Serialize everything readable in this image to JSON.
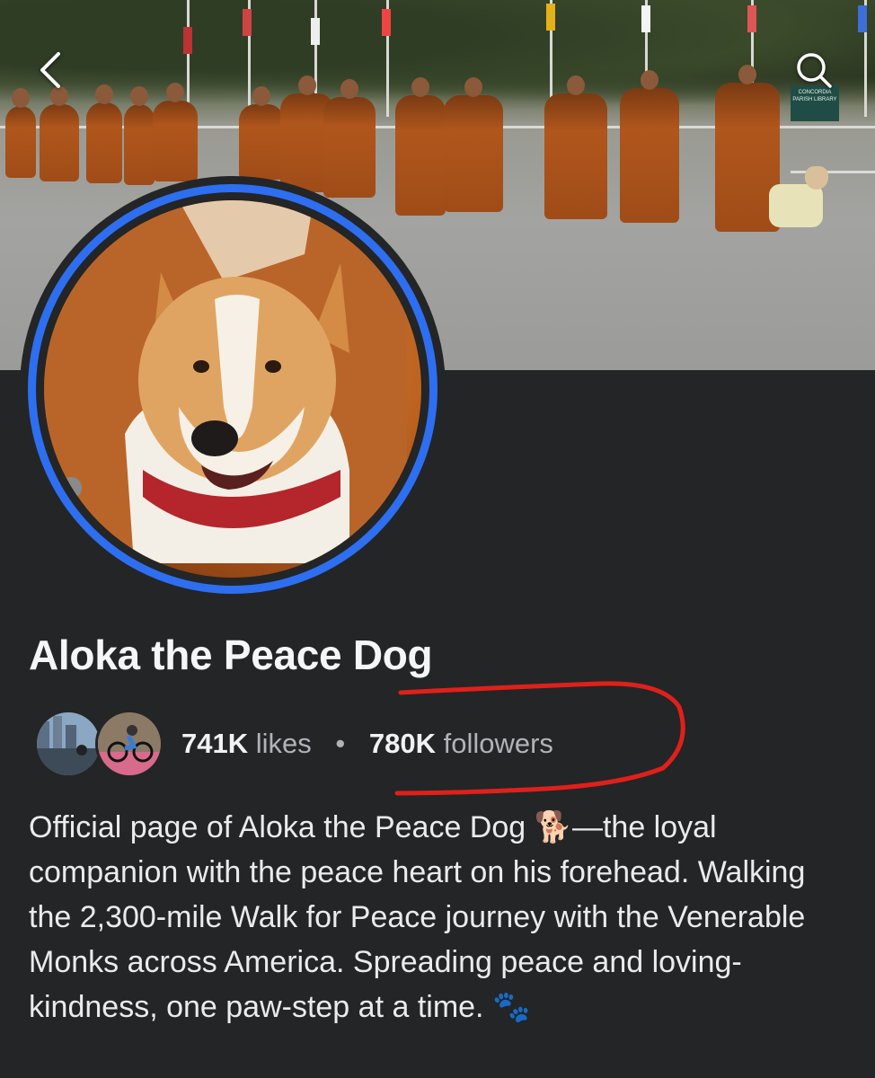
{
  "header": {
    "back_label": "Back",
    "search_label": "Search"
  },
  "cover": {
    "sign_text": "CONCORDIA PARISH LIBRARY"
  },
  "profile": {
    "name": "Aloka the Peace Dog",
    "likes_count": "741K",
    "likes_label": "likes",
    "separator": "•",
    "followers_count": "780K",
    "followers_label": "followers",
    "bio": "Official page of Aloka the Peace Dog 🐕—the loyal companion with the peace heart on his forehead. Walking the 2,300-mile Walk for Peace journey with the Venerable Monks across America. Spreading peace and loving-kindness, one paw-step at a time. 🐾"
  },
  "colors": {
    "background": "#242526",
    "avatar_ring": "#2d6ff0",
    "annotation": "#e0201b"
  },
  "icons": [
    "back-chevron-icon",
    "search-icon",
    "paw-icon",
    "dog-emoji"
  ]
}
